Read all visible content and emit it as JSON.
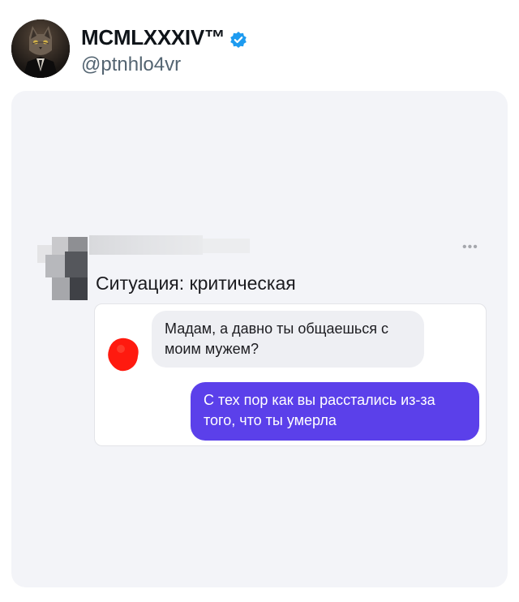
{
  "tweet": {
    "display_name": "MCMLXXXIV™",
    "handle": "@ptnhlo4vr",
    "verified_color": "#1d9bf0"
  },
  "screenshot": {
    "post_title": "Ситуация: критическая",
    "menu_glyph": "•••",
    "messages": [
      {
        "text": "Мадам, а давно ты общаешься с моим мужем?",
        "direction": "incoming",
        "bubble_color": "#eeeff3"
      },
      {
        "text": "С тех пор как вы расстались из-за того, что ты умерла",
        "direction": "outgoing",
        "bubble_color": "#5b40ea"
      }
    ]
  }
}
